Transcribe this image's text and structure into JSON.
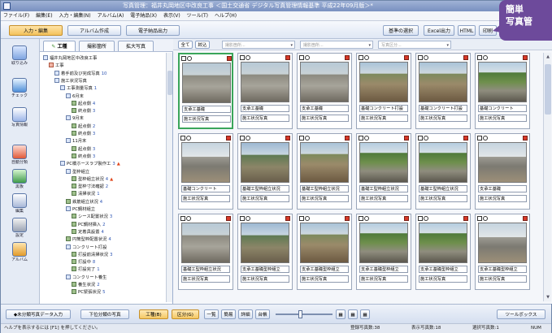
{
  "window": {
    "title": "写真管理：福井丸岡地区中改良工事 ＜国土交通省 デジタル写真管理情報基準 平成22年09月版＞*"
  },
  "menu": [
    "ファイル(F)",
    "編集(E)",
    "入力・編集(N)",
    "アルバム(A)",
    "電子納品(X)",
    "表示(V)",
    "ツール(T)",
    "ヘルプ(H)"
  ],
  "toolbar": {
    "left_tabs": [
      "入力・編集",
      "アルバム作成",
      "電子納品出力"
    ],
    "right_buttons": [
      "基準の選択",
      "Excel出力",
      "HTML",
      "印刷"
    ]
  },
  "leftnav": [
    {
      "icon": "import-icon",
      "label": "取り込み"
    },
    {
      "icon": "check-icon",
      "label": "チェック"
    },
    {
      "icon": "photo-info-icon",
      "label": "写真情報"
    },
    {
      "icon": "sort-icon",
      "label": "自動分類"
    },
    {
      "icon": "blackboard-icon",
      "label": "黒板"
    },
    {
      "icon": "edit-icon",
      "label": "編集"
    },
    {
      "icon": "settings-icon",
      "label": "設定"
    },
    {
      "icon": "album-icon",
      "label": "アルバム"
    }
  ],
  "tree": {
    "tabs": [
      "工種",
      "撮影箇所",
      "拡大写真"
    ],
    "nodes": [
      {
        "label": "福井丸岡地区中改良工事",
        "level": 0,
        "type": "root",
        "count": ""
      },
      {
        "label": "工事",
        "level": 1,
        "type": "r",
        "count": ""
      },
      {
        "label": "着手前及び完成写真",
        "level": 2,
        "type": "b",
        "count": "10"
      },
      {
        "label": "施工状況写真",
        "level": 2,
        "type": "b",
        "count": ""
      },
      {
        "label": "工事測量写真",
        "level": 3,
        "type": "b",
        "count": "1"
      },
      {
        "label": "6月末",
        "level": 4,
        "type": "b",
        "count": ""
      },
      {
        "label": "起点側",
        "level": 5,
        "type": "g",
        "count": "4"
      },
      {
        "label": "終点側",
        "level": 5,
        "type": "g",
        "count": "3"
      },
      {
        "label": "9月末",
        "level": 4,
        "type": "b",
        "count": ""
      },
      {
        "label": "起点側",
        "level": 5,
        "type": "g",
        "count": "2"
      },
      {
        "label": "終点側",
        "level": 5,
        "type": "g",
        "count": "3"
      },
      {
        "label": "11月末",
        "level": 4,
        "type": "b",
        "count": ""
      },
      {
        "label": "起点側",
        "level": 5,
        "type": "g",
        "count": "3"
      },
      {
        "label": "終点側",
        "level": 5,
        "type": "g",
        "count": "3"
      },
      {
        "label": "PC橋ホースラブ製作工",
        "level": 3,
        "type": "b",
        "count": "3",
        "warn": "▲"
      },
      {
        "label": "型枠組立",
        "level": 4,
        "type": "b",
        "count": ""
      },
      {
        "label": "型枠組立状況",
        "level": 5,
        "type": "g",
        "count": "4",
        "warn": "▲"
      },
      {
        "label": "型枠寸法確認",
        "level": 5,
        "type": "g",
        "count": "2"
      },
      {
        "label": "清掃状況",
        "level": 5,
        "type": "g",
        "count": "1"
      },
      {
        "label": "鉄筋組立状況",
        "level": 4,
        "type": "g",
        "count": "4"
      },
      {
        "label": "PC鋼材組立",
        "level": 4,
        "type": "b",
        "count": ""
      },
      {
        "label": "シース配置状況",
        "level": 5,
        "type": "g",
        "count": "3"
      },
      {
        "label": "PC鋼材挿入",
        "level": 5,
        "type": "g",
        "count": "2"
      },
      {
        "label": "定着具設置",
        "level": 5,
        "type": "g",
        "count": "4"
      },
      {
        "label": "円筒型枠配置状況",
        "level": 4,
        "type": "g",
        "count": "4"
      },
      {
        "label": "コンクリート打設",
        "level": 4,
        "type": "b",
        "count": ""
      },
      {
        "label": "打設前清掃状況",
        "level": 5,
        "type": "g",
        "count": "3"
      },
      {
        "label": "打設中",
        "level": 5,
        "type": "g",
        "count": "8"
      },
      {
        "label": "打設完了",
        "level": 5,
        "type": "g",
        "count": "1"
      },
      {
        "label": "コンクリート養生",
        "level": 4,
        "type": "b",
        "count": ""
      },
      {
        "label": "養生状況",
        "level": 5,
        "type": "g",
        "count": "2"
      },
      {
        "label": "PC緊張状況",
        "level": 5,
        "type": "g",
        "count": "5"
      }
    ]
  },
  "filterbar": {
    "btn_all": "全て",
    "btn_narrow": "絞込",
    "sel1": "撮影箇所...",
    "sel2": "撮影箇所...",
    "sel3": "写真区分..."
  },
  "photos": [
    {
      "cap1": "支承工基礎",
      "cap2": "施工状況写真",
      "scene": "road"
    },
    {
      "cap1": "支承工基礎",
      "cap2": "施工状況写真",
      "scene": "road"
    },
    {
      "cap1": "支承工基礎",
      "cap2": "施工状況写真",
      "scene": "road"
    },
    {
      "cap1": "基礎コンクリート打設",
      "cap2": "施工状況写真",
      "scene": "dirt"
    },
    {
      "cap1": "基礎コンクリート打設",
      "cap2": "施工状況写真",
      "scene": "dirt"
    },
    {
      "cap1": "基礎コンクリート",
      "cap2": "施工状況写真",
      "scene": "hill"
    },
    {
      "cap1": "基礎コンクリート",
      "cap2": "施工状況写真",
      "scene": "bridge"
    },
    {
      "cap1": "基礎工型枠組立状況",
      "cap2": "施工状況写真",
      "scene": "crane"
    },
    {
      "cap1": "基礎工型枠組立状況",
      "cap2": "施工状況写真",
      "scene": "dirt"
    },
    {
      "cap1": "基礎工型枠組立状況",
      "cap2": "施工状況写真",
      "scene": "hill"
    },
    {
      "cap1": "基礎工型枠組立状況",
      "cap2": "施工状況写真",
      "scene": "hill"
    },
    {
      "cap1": "支承工基礎",
      "cap2": "施工状況写真",
      "scene": "bridge"
    },
    {
      "cap1": "基礎工型枠組立状況",
      "cap2": "施工状況写真",
      "scene": "road"
    },
    {
      "cap1": "支承工基礎型枠組立",
      "cap2": "施工状況写真",
      "scene": "crane"
    },
    {
      "cap1": "支承工基礎型枠組立",
      "cap2": "施工状況写真",
      "scene": "dirt"
    },
    {
      "cap1": "支承工基礎型枠組立",
      "cap2": "施工状況写真",
      "scene": "hill"
    },
    {
      "cap1": "支承工基礎型枠組立",
      "cap2": "施工状況写真",
      "scene": "hill"
    },
    {
      "cap1": "支承工基礎型枠組立",
      "cap2": "施工状況写真",
      "scene": "bridge"
    }
  ],
  "bottombar": {
    "btn1": "◆未分類写真データ入力",
    "btn2": "下位分類の写真",
    "btn3": "工種(B)",
    "btn4": "区分(G)",
    "btn5": "一覧",
    "btn6": "簡易",
    "btn7": "詳細",
    "btn8": "台帳",
    "btn9": "ツールボックス"
  },
  "status": {
    "help": "ヘルプを表示するには [F1] を押してください。",
    "registered": "登録写真数:38",
    "shown": "表示写真数:18",
    "selected": "選択写真数:1",
    "num": "NUM"
  },
  "badge": {
    "line1": "簡単",
    "line2": "写真管"
  }
}
